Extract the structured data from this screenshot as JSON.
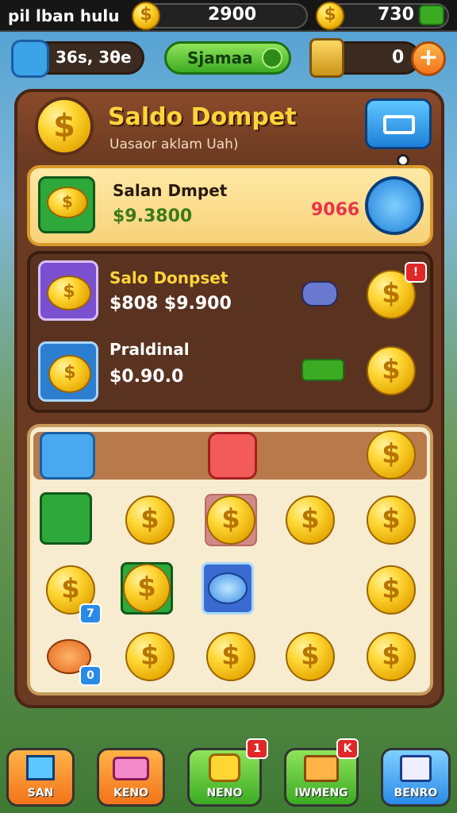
{
  "hud": {
    "player_name": "pil lban hulu",
    "coins_1": "2900",
    "coins_2": "730"
  },
  "subbar": {
    "counter_label": "36s, 3θe",
    "green_button_label": "Sjamaa",
    "plus_count": "0"
  },
  "wallet": {
    "title": "Saldo Dompet",
    "subtitle": "Uasaor aklam Uah)",
    "featured": {
      "title": "Salan Dmpet",
      "amount": "$9.3800",
      "value": "9066"
    },
    "offers": [
      {
        "title": "Salo Donpset",
        "amount": "$808 $9.900",
        "badge": "!"
      },
      {
        "title": "Praldinal",
        "amount": "$0.90.0"
      }
    ]
  },
  "grid": {
    "badge_7": "7",
    "badge_0": "0"
  },
  "nav": [
    {
      "label": "SAN"
    },
    {
      "label": "KENO"
    },
    {
      "label": "NENO",
      "badge": "1"
    },
    {
      "label": "IWMENG",
      "badge": "K"
    },
    {
      "label": "BENRO"
    }
  ],
  "colors": {
    "accent_gold": "#ffd633",
    "panel_brown": "#6b3a22",
    "title_gold": "#ffd43b",
    "price_red": "#e8354a"
  }
}
